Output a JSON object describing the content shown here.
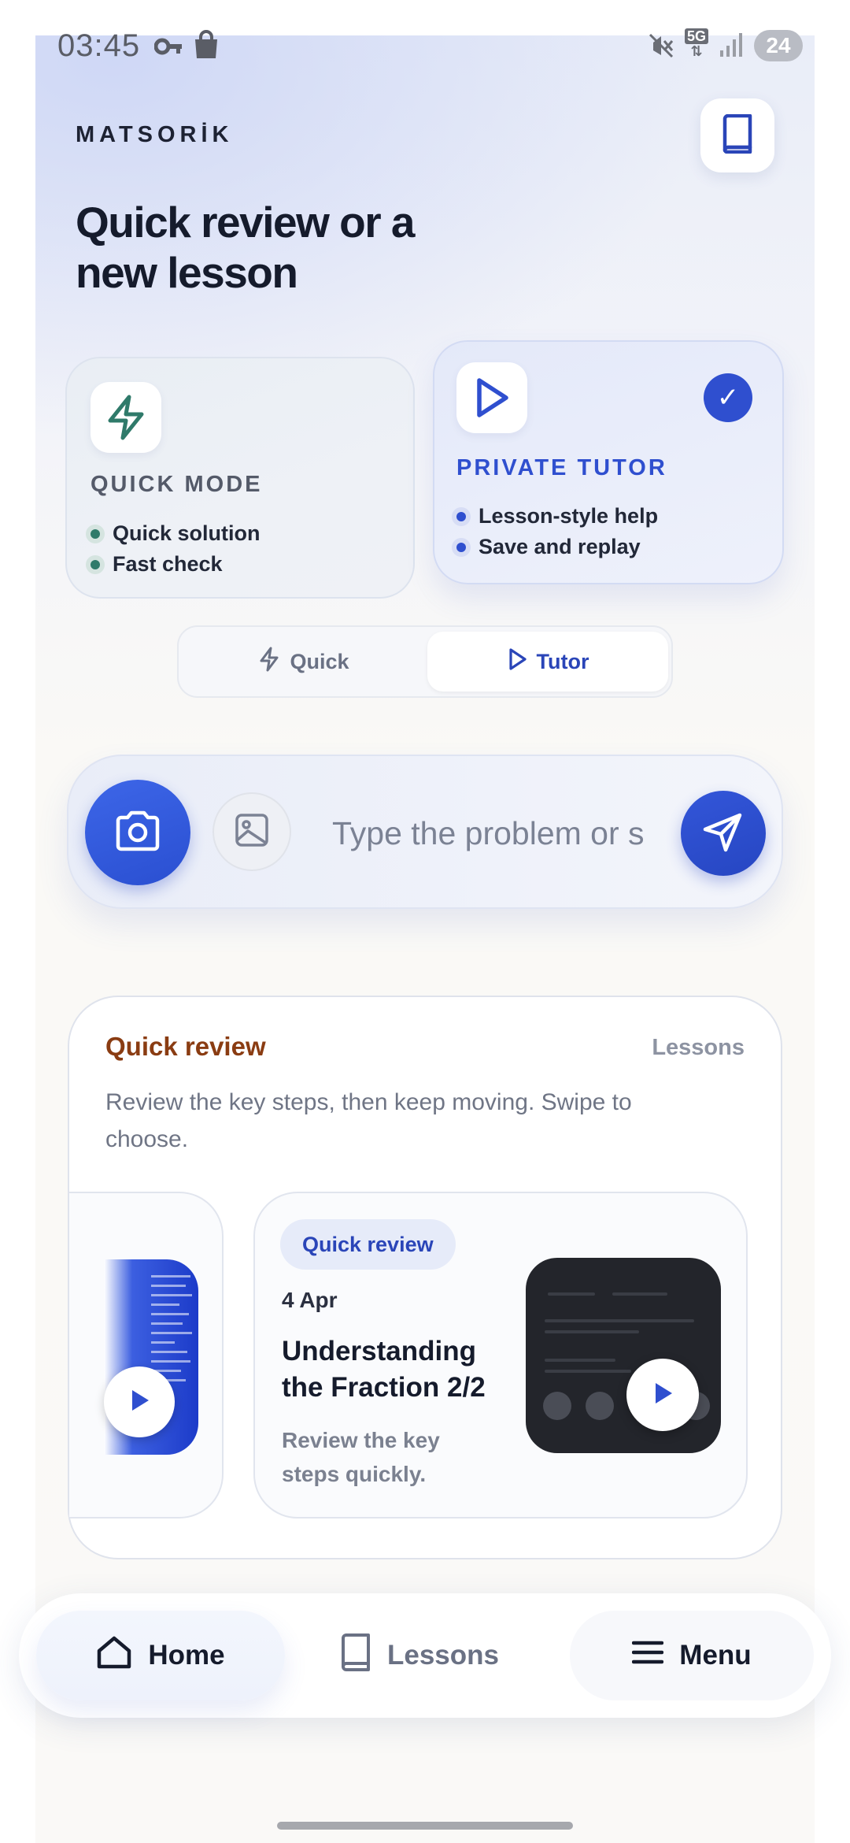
{
  "status_bar": {
    "time": "03:45",
    "network": "5G",
    "battery": "24"
  },
  "header": {
    "brand": "MATSORİK",
    "headline": "Quick review or a new lesson"
  },
  "modes": {
    "quick": {
      "title": "QUICK MODE",
      "bullets": [
        "Quick solution",
        "Fast check"
      ],
      "color": "#2f7a6a"
    },
    "tutor": {
      "title": "PRIVATE TUTOR",
      "bullets": [
        "Lesson-style help",
        "Save and replay"
      ],
      "selected_mark": "✓",
      "color": "#2f4fcf"
    }
  },
  "segment": {
    "quick_label": "Quick",
    "tutor_label": "Tutor",
    "selected": "Tutor"
  },
  "composer": {
    "placeholder": "Type the problem or s"
  },
  "review": {
    "title": "Quick review",
    "link": "Lessons",
    "description": "Review the key steps, then keep moving. Swipe to choose.",
    "card": {
      "badge": "Quick review",
      "date": "4 Apr",
      "title": "Understanding the Fraction 2/2",
      "description": "Review the key steps quickly."
    }
  },
  "nav": {
    "home": "Home",
    "lessons": "Lessons",
    "menu": "Menu"
  },
  "colors": {
    "accent": "#2f4fcf",
    "review_title": "#8a3c12"
  }
}
